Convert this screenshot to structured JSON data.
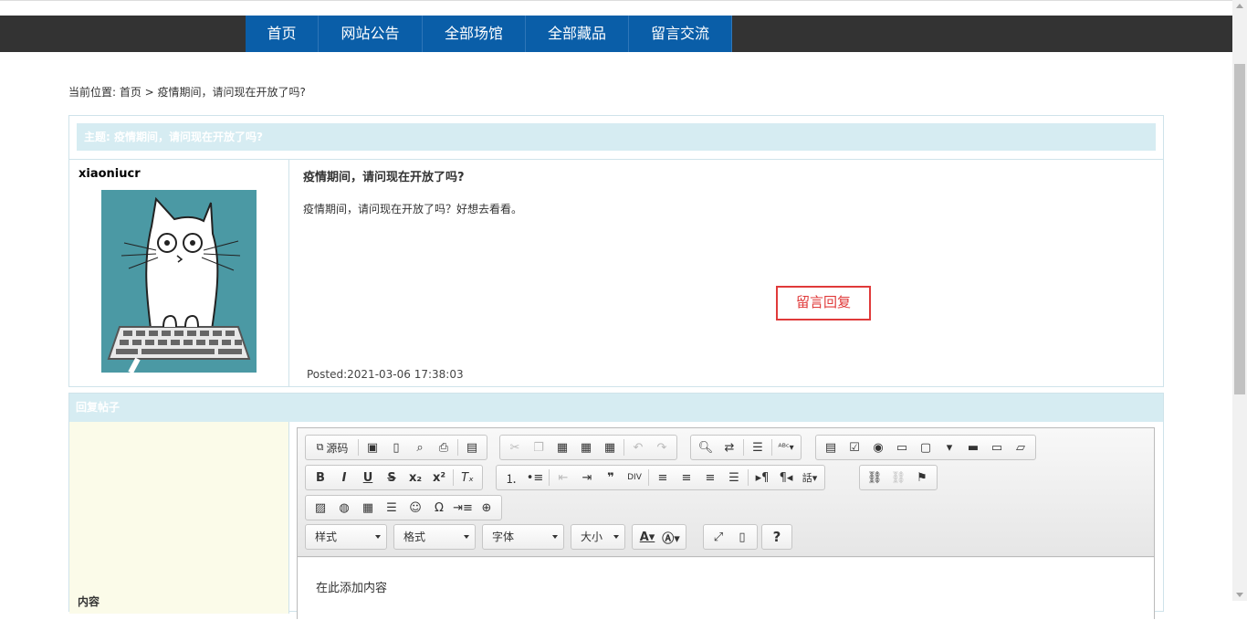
{
  "nav": {
    "items": [
      "首页",
      "网站公告",
      "全部场馆",
      "全部藏品",
      "留言交流"
    ]
  },
  "breadcrumb": "当前位置: 首页 > 疫情期间，请问现在开放了吗?",
  "post": {
    "subject_label": "主题: 疫情期间，请问现在开放了吗?",
    "username": "xiaoniucr",
    "title": "疫情期间，请问现在开放了吗?",
    "body": "疫情期间，请问现在开放了吗？好想去看看。",
    "reply_button": "留言回复",
    "posted": "Posted:2021-03-06 17:38:03"
  },
  "reply": {
    "header": "回复帖子",
    "content_label": "内容",
    "editor": {
      "source_label": "源码",
      "style_combo": "样式",
      "format_combo": "格式",
      "font_combo": "字体",
      "size_combo": "大小",
      "help_label": "?",
      "placeholder_text": "在此添加内容"
    }
  },
  "colors": {
    "nav_bg": "#333333",
    "nav_active": "#0a5ea8",
    "header_bar": "#d6ecf2",
    "reply_btn": "#e03a3a",
    "avatar_bg": "#4b99a4"
  }
}
